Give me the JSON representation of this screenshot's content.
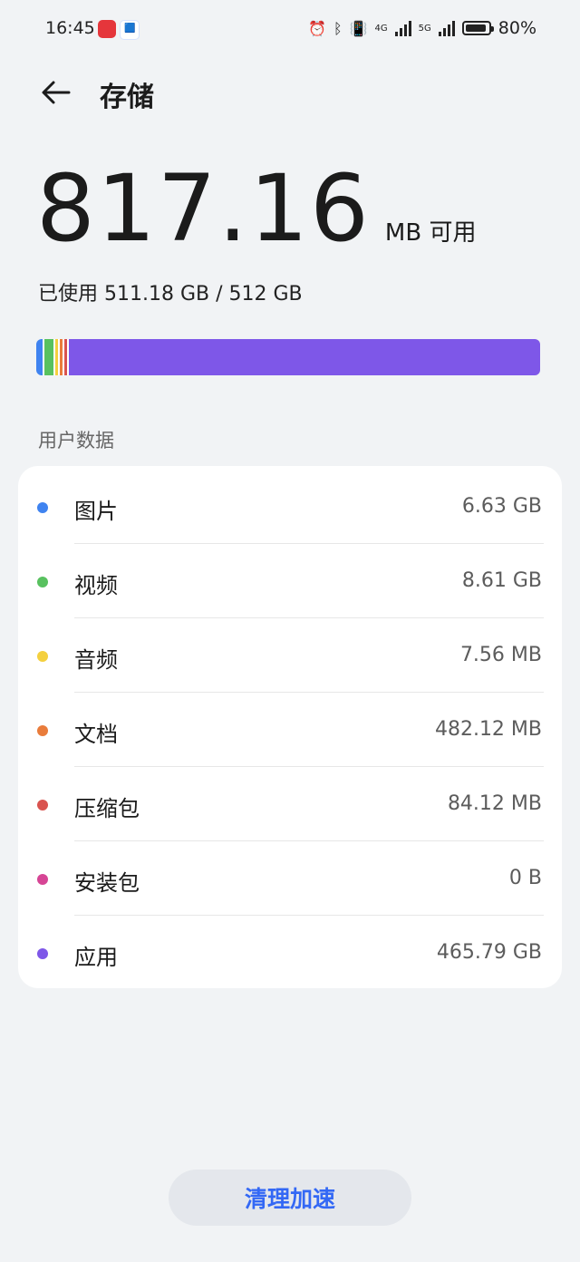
{
  "status_bar": {
    "time": "16:45",
    "battery_text": "80%",
    "battery_level": 0.8,
    "net_4g": "4G",
    "net_5g": "5G"
  },
  "header": {
    "title": "存储",
    "back_icon": "back-arrow-icon"
  },
  "storage": {
    "available_value": "817.16",
    "available_unit": "MB 可用",
    "used_text": "已使用 511.18 GB / 512 GB"
  },
  "usage_bar": {
    "segments": [
      {
        "category": "图片",
        "color": "#3f83f0",
        "fraction": 0.013
      },
      {
        "category": "视频",
        "color": "#58c15f",
        "fraction": 0.017
      },
      {
        "category": "音频",
        "color": "#f4d03f",
        "fraction": 0.006
      },
      {
        "category": "文档",
        "color": "#e97c3b",
        "fraction": 0.006
      },
      {
        "category": "压缩包",
        "color": "#d9534f",
        "fraction": 0.006
      },
      {
        "category": "应用",
        "color": "#7e57e8",
        "fraction": 0.94
      }
    ]
  },
  "section_label": "用户数据",
  "categories": [
    {
      "label": "图片",
      "size": "6.63 GB",
      "color": "#3f83f0"
    },
    {
      "label": "视频",
      "size": "8.61 GB",
      "color": "#58c15f"
    },
    {
      "label": "音频",
      "size": "7.56 MB",
      "color": "#f4d03f"
    },
    {
      "label": "文档",
      "size": "482.12 MB",
      "color": "#e97c3b"
    },
    {
      "label": "压缩包",
      "size": "84.12 MB",
      "color": "#d9534f"
    },
    {
      "label": "安装包",
      "size": "0 B",
      "color": "#d64595"
    },
    {
      "label": "应用",
      "size": "465.79 GB",
      "color": "#7e57e8"
    }
  ],
  "clean_button": {
    "label": "清理加速"
  }
}
